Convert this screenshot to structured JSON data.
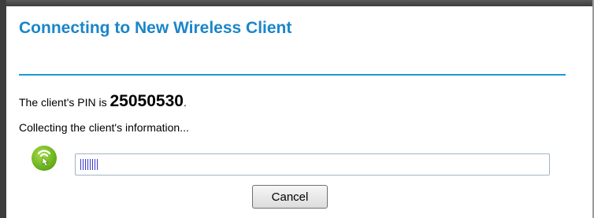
{
  "dialog": {
    "title": "Connecting to New Wireless Client",
    "pin_prefix": "The client's PIN is ",
    "pin": "25050530",
    "pin_suffix": ".",
    "status_text": "Collecting the client's information...",
    "progress_fraction": 0.04,
    "cancel_label": "Cancel",
    "icon": "wps-icon"
  },
  "colors": {
    "title": "#1a86c8",
    "rule": "#1a9ad6",
    "progress_fill": "#3b3ad0",
    "icon_green": "#6bb21e"
  }
}
